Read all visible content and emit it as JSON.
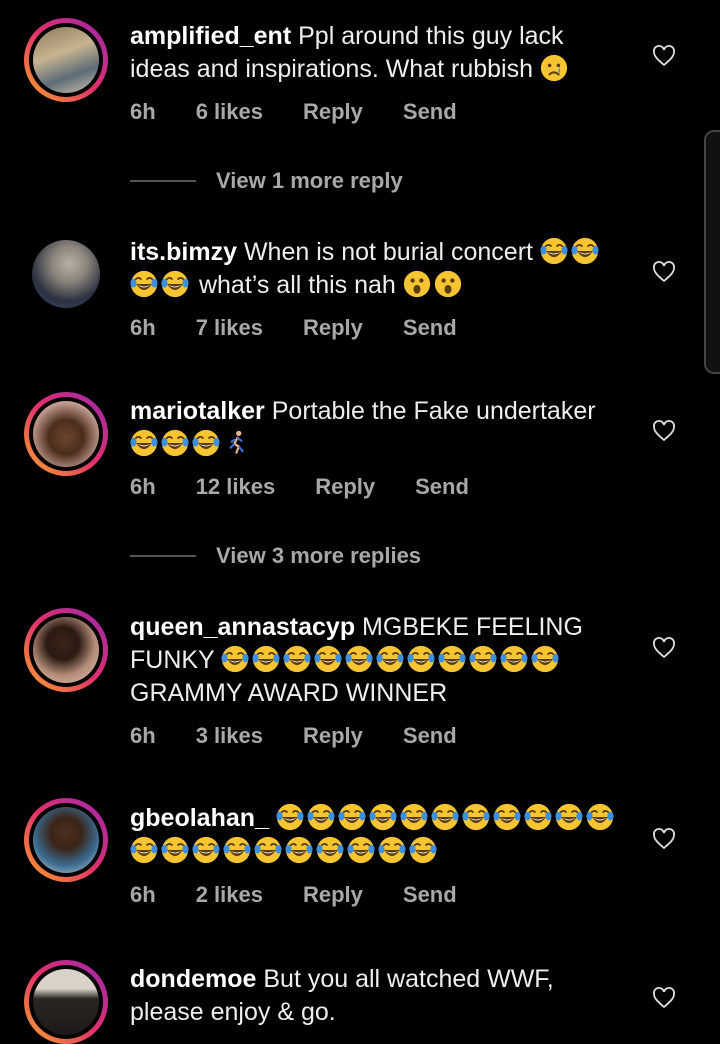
{
  "comments": [
    {
      "user": "amplified_ent",
      "text": "Ppl around this guy lack ideas and inspirations. What rubbish",
      "emojis_after": [
        "cry"
      ],
      "time": "6h",
      "likes": "6 likes",
      "reply": "Reply",
      "send": "Send",
      "ring": true
    },
    {
      "user": "its.bimzy",
      "text": "When is not burial concert",
      "emojis_mid": [
        "laugh",
        "laugh",
        "laugh",
        "laugh"
      ],
      "text2": "what’s all this nah",
      "emojis_after": [
        "wow",
        "wow"
      ],
      "time": "6h",
      "likes": "7 likes",
      "reply": "Reply",
      "send": "Send",
      "ring": false
    },
    {
      "user": "mariotalker",
      "text": "Portable the Fake undertaker",
      "emojis_after": [
        "laugh",
        "laugh",
        "laugh",
        "run"
      ],
      "time": "6h",
      "likes": "12 likes",
      "reply": "Reply",
      "send": "Send",
      "ring": true
    },
    {
      "user": "queen_annastacyp",
      "text": "MGBEKE FEELING FUNKY",
      "emojis_mid": [
        "laugh",
        "laugh",
        "laugh",
        "laugh",
        "laugh",
        "laugh",
        "laugh",
        "laugh",
        "laugh",
        "laugh",
        "laugh"
      ],
      "text2": "GRAMMY AWARD WINNER",
      "time": "6h",
      "likes": "3 likes",
      "reply": "Reply",
      "send": "Send",
      "ring": true
    },
    {
      "user": "gbeolahan_",
      "emojis_after": [
        "laugh",
        "laugh",
        "laugh",
        "laugh",
        "laugh",
        "laugh",
        "laugh",
        "laugh",
        "laugh",
        "laugh",
        "laugh",
        "laugh",
        "laugh",
        "laugh",
        "laugh",
        "laugh",
        "laugh",
        "laugh",
        "laugh",
        "laugh",
        "laugh"
      ],
      "time": "6h",
      "likes": "2 likes",
      "reply": "Reply",
      "send": "Send",
      "ring": true
    },
    {
      "user": "dondemoe",
      "text": "But you all watched WWF, please enjoy & go.",
      "ring": true
    }
  ],
  "view_more": [
    "View 1 more reply",
    "View 3 more replies"
  ],
  "icons": {
    "like": "heart-outline-icon",
    "emoji_laugh": "tears-of-joy",
    "emoji_cry": "crying-face",
    "emoji_wow": "astonished-face",
    "emoji_run": "person-running"
  },
  "colors": {
    "background": "#000000",
    "ring_start": "#f9a825",
    "ring_mid": "#e1306c",
    "ring_end": "#9c27b0",
    "meta": "#a8a8a8"
  }
}
